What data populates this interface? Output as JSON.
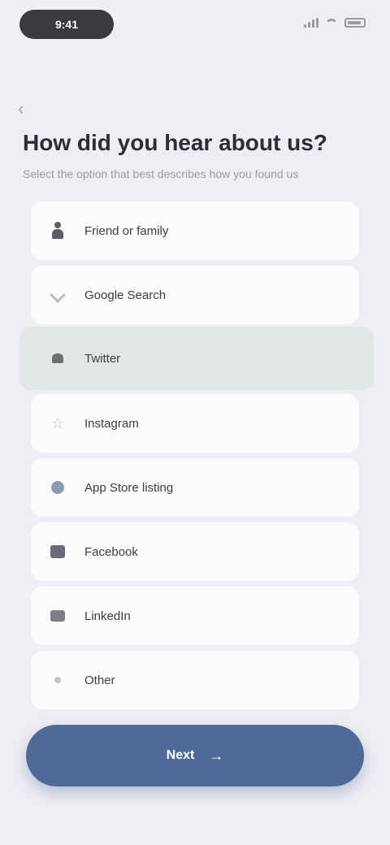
{
  "status_bar": {
    "time": "9:41"
  },
  "header": {
    "back_icon": "chevron-left-icon",
    "title": "How did you hear about us?",
    "subtitle": "Select the option that best describes how you found us"
  },
  "options": [
    {
      "label": "Friend or family",
      "icon": "person-icon",
      "selected": false
    },
    {
      "label": "Google Search",
      "icon": "arrow-icon",
      "selected": false
    },
    {
      "label": "Twitter",
      "icon": "heart-icon",
      "selected": true
    },
    {
      "label": "Instagram",
      "icon": "star-icon",
      "selected": false
    },
    {
      "label": "App Store listing",
      "icon": "globe-icon",
      "selected": false
    },
    {
      "label": "Facebook",
      "icon": "grid-icon",
      "selected": false
    },
    {
      "label": "LinkedIn",
      "icon": "bag-icon",
      "selected": false
    },
    {
      "label": "Other",
      "icon": "dot-icon",
      "selected": false
    }
  ],
  "footer": {
    "next_label": "Next",
    "next_icon": "arrow-right-icon"
  },
  "colors": {
    "accent": "#4f6a97",
    "selected_bg": "#e1e8e3",
    "background": "#eeeef3"
  }
}
